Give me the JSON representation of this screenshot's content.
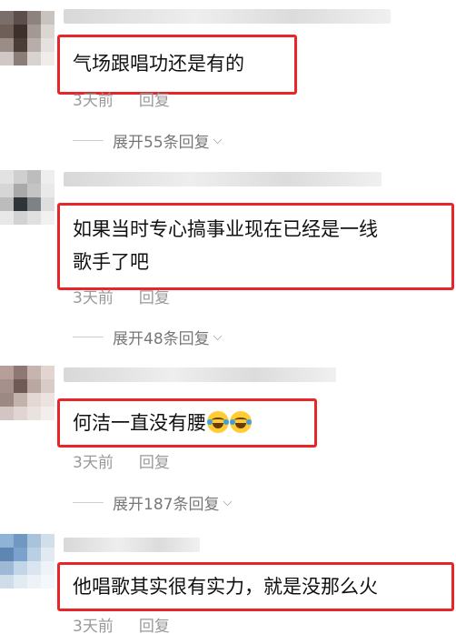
{
  "comments": [
    {
      "text": "气场跟唱功还是有的",
      "time": "3天前",
      "reply": "回复",
      "expand": "展开55条回复",
      "avatar_colors": [
        "#7a6e6a",
        "#5c4f4b",
        "#8d827e",
        "#c9c3c0",
        "#6e5f58",
        "#3d2f2a",
        "#a39894",
        "#dcd6d3",
        "#9a8d87",
        "#4a3c37",
        "#b7aeaa",
        "#e5e1df",
        "#cfc8c5",
        "#8a7d78",
        "#d9d3d0",
        "#efecea"
      ]
    },
    {
      "text": "如果当时专心搞事业现在已经是一线\n歌手了吧",
      "time": "3天前",
      "reply": "回复",
      "expand": "展开48条回复",
      "avatar_colors": [
        "#e2e2e2",
        "#cfcfcf",
        "#bdbdbd",
        "#eeeeee",
        "#d6d6d6",
        "#a9a9a9",
        "#c4c4c4",
        "#e9e9e9",
        "#bcbcbc",
        "#2f3438",
        "#7d8286",
        "#dedede",
        "#e8e8e8",
        "#d2d2d2",
        "#e0e0e0",
        "#f1f1f1"
      ]
    },
    {
      "text": "何洁一直没有腰",
      "time": "3天前",
      "reply": "回复",
      "expand": "展开187条回复",
      "emojis": [
        "rolling-laughing-emoji",
        "rolling-laughing-emoji"
      ],
      "avatar_colors": [
        "#b79e99",
        "#8f7873",
        "#c8b4ae",
        "#e2d5d1",
        "#a5908b",
        "#6f5a55",
        "#bba7a2",
        "#d9cbc7",
        "#9d8984",
        "#c4b2ad",
        "#e4d8d4",
        "#ecE3e0",
        "#d3c5c1",
        "#e0d5d2",
        "#eae2df",
        "#f3eeec"
      ]
    },
    {
      "text": "他唱歌其实很有实力，就是没那么火",
      "time": "3天前",
      "reply": "回复",
      "avatar_colors": [
        "#8fb3d6",
        "#6f98c2",
        "#a9c3dc",
        "#d2dfea",
        "#5d86b3",
        "#7aa2cc",
        "#b9cfe3",
        "#e1e9f1",
        "#9db9d6",
        "#c3d6e8",
        "#dbe5ef",
        "#eef3f7",
        "#cfdcea",
        "#e2eaf2",
        "#edf2f7",
        "#f5f8fb"
      ]
    }
  ]
}
